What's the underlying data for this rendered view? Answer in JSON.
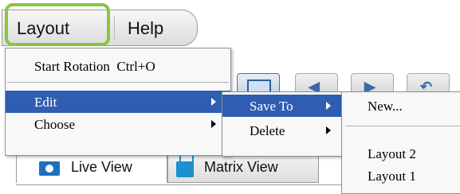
{
  "menubar": {
    "layout_label": "Layout",
    "help_label": "Help"
  },
  "layout_menu": {
    "start_rotation": "Start Rotation",
    "start_rotation_shortcut": "Ctrl+O",
    "edit": "Edit",
    "choose": "Choose"
  },
  "edit_submenu": {
    "save_to": "Save To",
    "delete": "Delete"
  },
  "save_to_submenu": {
    "new": "New...",
    "items": [
      "Layout 2",
      "Layout 1"
    ]
  },
  "tabs": {
    "live_view": "Live View",
    "matrix_view": "Matrix View"
  },
  "colors": {
    "highlight": "#8bc53f",
    "selection": "#2f5db2"
  }
}
